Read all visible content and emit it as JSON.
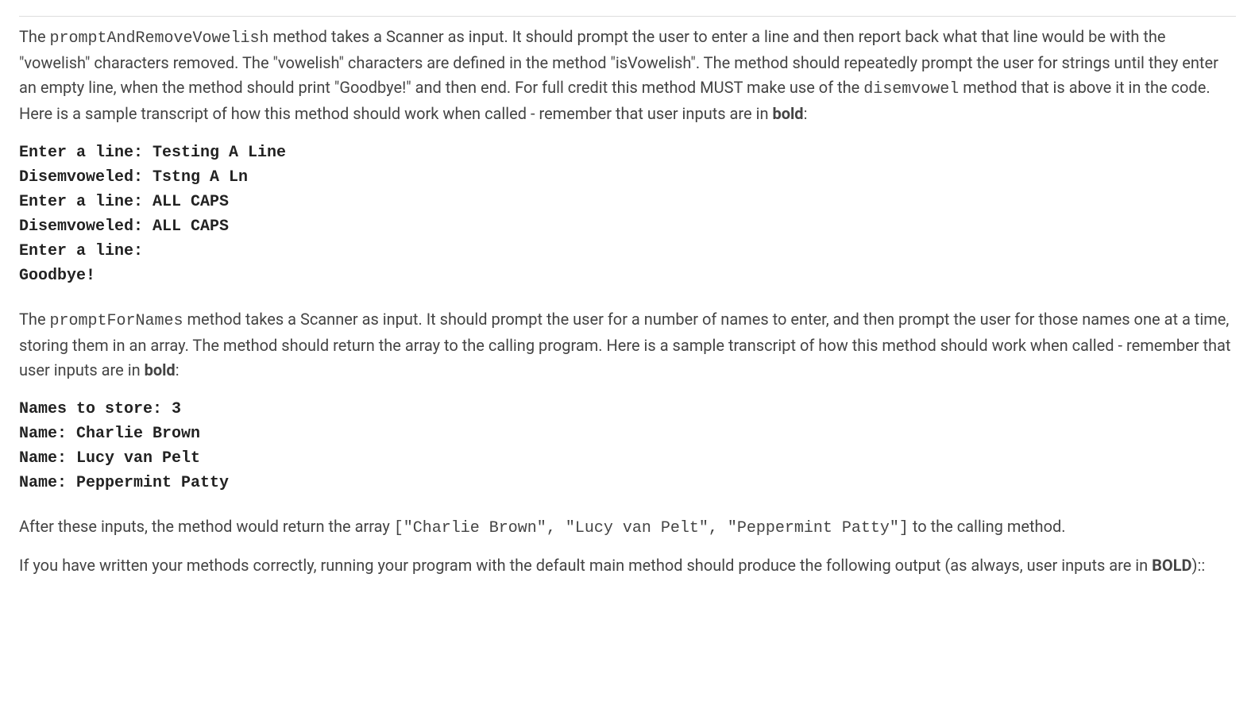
{
  "para1": {
    "t0": "The ",
    "method1": "promptAndRemoveVowelish",
    "t1": " method takes a Scanner as input. It should prompt the user to enter a line and then report back what that line would be with the \"vowelish\" characters removed. The \"vowelish\" characters are defined in the method \"isVowelish\". The method should repeatedly prompt the user for strings until they enter an empty line, when the method should print \"Goodbye!\" and then end. For full credit this method MUST make use of the ",
    "method2": "disemvowel",
    "t2": " method that is above it in the code. Here is a sample transcript of how this method should work when called - remember that user inputs are in ",
    "boldword": "bold",
    "t3": ":"
  },
  "transcript1": {
    "l1p": "Enter a line: ",
    "l1i": "Testing A Line",
    "l2": "Disemvoweled: Tstng A Ln",
    "l3p": "Enter a line: ",
    "l3i": "ALL CAPS",
    "l4": "Disemvoweled: ALL CAPS",
    "l5": "Enter a line:",
    "l6": "Goodbye!"
  },
  "para2": {
    "t0": "The ",
    "method1": "promptForNames",
    "t1": " method takes a Scanner as input. It should prompt the user for a number of names to enter, and then prompt the user for those names one at a time, storing them in an array. The method should return the array to the calling program. Here is a sample transcript of how this method should work when called - remember that user inputs are in ",
    "boldword": "bold",
    "t2": ":"
  },
  "transcript2": {
    "l1p": "Names to store: ",
    "l1i": "3",
    "l2p": "Name: ",
    "l2i": "Charlie Brown",
    "l3p": "Name: ",
    "l3i": "Lucy van Pelt",
    "l4p": "Name: ",
    "l4i": "Peppermint Patty"
  },
  "para3": {
    "t0": "After these inputs, the method would return the array ",
    "code": "[\"Charlie Brown\", \"Lucy van Pelt\", \"Peppermint Patty\"]",
    "t1": " to the calling method."
  },
  "para4": {
    "t0": "If you have written your methods correctly, running your program with the default main method should produce the following output (as always, user inputs are in ",
    "boldword": "BOLD",
    "t1": ")::"
  }
}
